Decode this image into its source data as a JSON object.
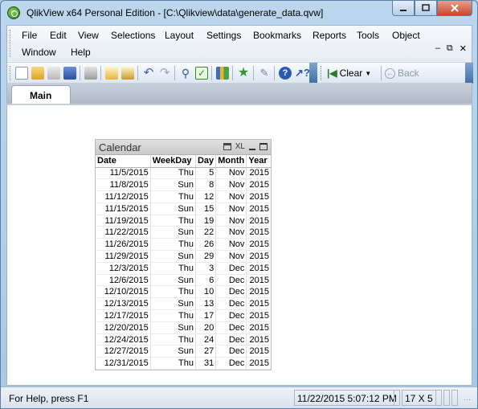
{
  "window": {
    "title": "QlikView x64 Personal Edition - [C:\\Qlikview\\data\\generate_data.qvw]"
  },
  "menu": [
    "File",
    "Edit",
    "View",
    "Selections",
    "Layout",
    "Settings",
    "Bookmarks",
    "Reports",
    "Tools",
    "Object",
    "Window",
    "Help"
  ],
  "toolbar": {
    "clear_label": "Clear",
    "back_label": "Back"
  },
  "tabs": [
    {
      "label": "Main"
    }
  ],
  "table": {
    "title": "Calendar",
    "xl_label": "XL",
    "columns": [
      "Date",
      "WeekDay",
      "Day",
      "Month",
      "Year"
    ],
    "rows": [
      [
        "11/5/2015",
        "Thu",
        "5",
        "Nov",
        "2015"
      ],
      [
        "11/8/2015",
        "Sun",
        "8",
        "Nov",
        "2015"
      ],
      [
        "11/12/2015",
        "Thu",
        "12",
        "Nov",
        "2015"
      ],
      [
        "11/15/2015",
        "Sun",
        "15",
        "Nov",
        "2015"
      ],
      [
        "11/19/2015",
        "Thu",
        "19",
        "Nov",
        "2015"
      ],
      [
        "11/22/2015",
        "Sun",
        "22",
        "Nov",
        "2015"
      ],
      [
        "11/26/2015",
        "Thu",
        "26",
        "Nov",
        "2015"
      ],
      [
        "11/29/2015",
        "Sun",
        "29",
        "Nov",
        "2015"
      ],
      [
        "12/3/2015",
        "Thu",
        "3",
        "Dec",
        "2015"
      ],
      [
        "12/6/2015",
        "Sun",
        "6",
        "Dec",
        "2015"
      ],
      [
        "12/10/2015",
        "Thu",
        "10",
        "Dec",
        "2015"
      ],
      [
        "12/13/2015",
        "Sun",
        "13",
        "Dec",
        "2015"
      ],
      [
        "12/17/2015",
        "Thu",
        "17",
        "Dec",
        "2015"
      ],
      [
        "12/20/2015",
        "Sun",
        "20",
        "Dec",
        "2015"
      ],
      [
        "12/24/2015",
        "Thu",
        "24",
        "Dec",
        "2015"
      ],
      [
        "12/27/2015",
        "Sun",
        "27",
        "Dec",
        "2015"
      ],
      [
        "12/31/2015",
        "Thu",
        "31",
        "Dec",
        "2015"
      ]
    ]
  },
  "status": {
    "help": "For Help, press F1",
    "datetime": "11/22/2015 5:07:12 PM",
    "dims": "17 X 5"
  },
  "colors": {
    "accent": "#3f6ea8",
    "caption": "#cfcfcf"
  }
}
